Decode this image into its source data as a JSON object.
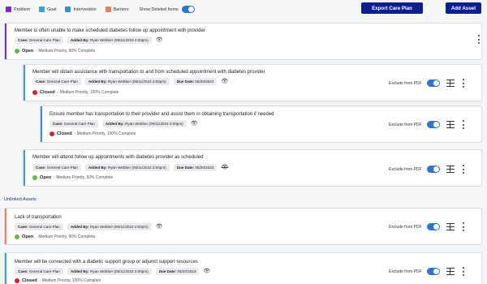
{
  "legend": {
    "items": [
      {
        "label": "Problem",
        "color": "#7b2ec9"
      },
      {
        "label": "Goal",
        "color": "#3aa3c9"
      },
      {
        "label": "Intervention",
        "color": "#3a8fc9"
      },
      {
        "label": "Barriers",
        "color": "#e8825a"
      }
    ],
    "show_deleted_label": "Show Deleted Items",
    "show_deleted_on": true
  },
  "toolbar": {
    "export_label": "Export Care Plan",
    "add_label": "Add Asset"
  },
  "colors": {
    "accent_primary": "#0d1f8f",
    "open_status": "#6db33f",
    "closed_status": "#d4232a",
    "toggle_on": "#2f74d0"
  },
  "cards": [
    {
      "title": "Member is often unable to make scheduled diabetes follow up appointment with provider",
      "case": "General Care Plan",
      "added_by": "Ryan Webber (05/11/2023 2:00pm)",
      "status": "Open",
      "status_detail": "- Medium Priority, 90% Complete"
    },
    {
      "title": "Member will obtain assistance with transportation to and from scheduled appointment with diabetes provider",
      "case": "General Care Plan",
      "added_by": "Ryan Webber (05/11/2023 2:00pm)",
      "due_date": "05/20/2023",
      "status": "Closed",
      "status_detail": "- Medium Priority, 100% Complete",
      "exclude_label": "Exclude from PDF"
    },
    {
      "title": "Ensure member has transportation to their provider and assist them in obtaining transportation if needed",
      "case": "General Care Plan",
      "added_by": "Ryan Webber (05/11/2023 2:00pm)",
      "status": "Closed",
      "status_detail": "- Medium Priority, 100% Complete",
      "exclude_label": "Exclude from PDF"
    },
    {
      "title": "Member will attend follow up appointments with diabetes provider as scheduled",
      "case": "General Care Plan",
      "added_by": "Ryan Webber (05/11/2023 2:00pm)",
      "due_date": "05/20/2023",
      "status": "Open",
      "status_detail": "- Medium Priority, 50% Complete",
      "exclude_label": "Exclude from PDF"
    }
  ],
  "unlinked": {
    "label": "Unlinked Assets",
    "cards": [
      {
        "title": "Lack of transportation",
        "case": "General Care Plan",
        "added_by": "Ryan Webber (05/11/2023 2:00pm)",
        "status": "Open",
        "status_detail": "- Medium Priority, 90% Complete",
        "exclude_label": "Exclude from PDF"
      },
      {
        "title": "Member will be connected with a diabetic support group or adjunct support resources",
        "case": "General Care Plan",
        "added_by": "Ryan Webber (05/11/2023 2:00pm)",
        "due_date": "05/20/2023",
        "status": "Closed",
        "status_detail": "- Medium Priority, 100% Complete",
        "exclude_label": "Exclude from PDF"
      }
    ]
  },
  "labels": {
    "case_prefix": "Case:",
    "added_prefix": "Added By:",
    "due_prefix": "Due Date:"
  }
}
